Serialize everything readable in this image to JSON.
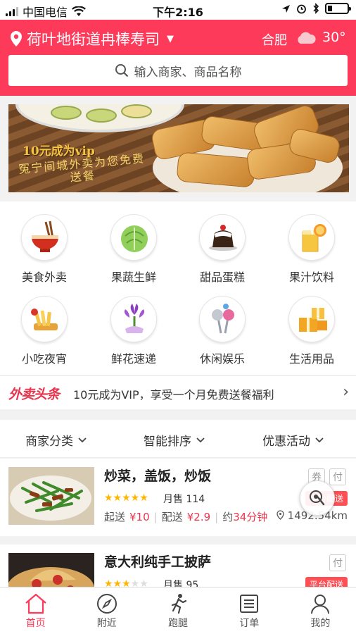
{
  "status_bar": {
    "carrier": "中国电信",
    "time": "下午2:16"
  },
  "header": {
    "location": "荷叶地街道冉棒寿司",
    "city": "合肥",
    "temperature": "30°",
    "weather_icon": "cloud-icon"
  },
  "search": {
    "placeholder": "输入商家、商品名称"
  },
  "banner": {
    "title": "10元成为vip",
    "subtitle": "冤宁间城外卖为您免费送餐"
  },
  "categories": [
    {
      "label": "美食外卖",
      "icon": "noodle-bowl-icon"
    },
    {
      "label": "果蔬生鲜",
      "icon": "cabbage-icon"
    },
    {
      "label": "甜品蛋糕",
      "icon": "pudding-icon"
    },
    {
      "label": "果汁饮料",
      "icon": "juice-icon"
    },
    {
      "label": "小吃夜宵",
      "icon": "fries-icon"
    },
    {
      "label": "鲜花速递",
      "icon": "flower-icon"
    },
    {
      "label": "休闲娱乐",
      "icon": "microphone-icon"
    },
    {
      "label": "生活用品",
      "icon": "gift-box-icon"
    }
  ],
  "news": {
    "tag": "外卖头条",
    "text": "10元成为VIP，享受一个月免费送餐福利"
  },
  "filters": [
    {
      "label": "商家分类"
    },
    {
      "label": "智能排序"
    },
    {
      "label": "优惠活动"
    }
  ],
  "shops": [
    {
      "name": "炒菜，盖饭，炒饭",
      "badges": [
        "券",
        "付"
      ],
      "rating": 5,
      "sold": "月售 114",
      "platform": "平台配送",
      "min_order_label": "起送",
      "min_order": "¥10",
      "delivery_label": "配送",
      "delivery_fee": "¥2.9",
      "time_label": "约",
      "time": "34分钟",
      "distance": "1492.54km"
    },
    {
      "name": "意大利纯手工披萨",
      "badges": [
        "付"
      ],
      "rating": 3,
      "sold": "月售 95",
      "platform": "平台配送"
    }
  ],
  "tabbar": [
    {
      "label": "首页",
      "icon": "home-icon",
      "active": true
    },
    {
      "label": "附近",
      "icon": "compass-icon",
      "active": false
    },
    {
      "label": "跑腿",
      "icon": "runner-icon",
      "active": false
    },
    {
      "label": "订单",
      "icon": "order-list-icon",
      "active": false
    },
    {
      "label": "我的",
      "icon": "user-icon",
      "active": false
    }
  ],
  "colors": {
    "brand": "#fd3a5a",
    "price_red": "#e8344c",
    "star": "#ffb400"
  }
}
